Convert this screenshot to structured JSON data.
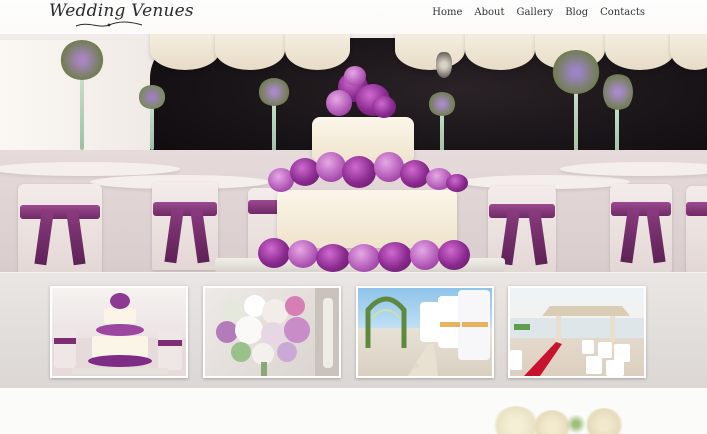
{
  "header": {
    "logo_text": "Wedding Venues",
    "nav": [
      "Home",
      "About",
      "Gallery",
      "Blog",
      "Contacts"
    ]
  },
  "colors": {
    "accent_purple": "#7a2e72",
    "text": "#333333",
    "strip_bg": "#e4e0dd"
  },
  "gallery": {
    "thumbnails": [
      "cake-thumbnail",
      "bouquet-thumbnail",
      "aisle-thumbnail",
      "gazebo-thumbnail"
    ]
  }
}
